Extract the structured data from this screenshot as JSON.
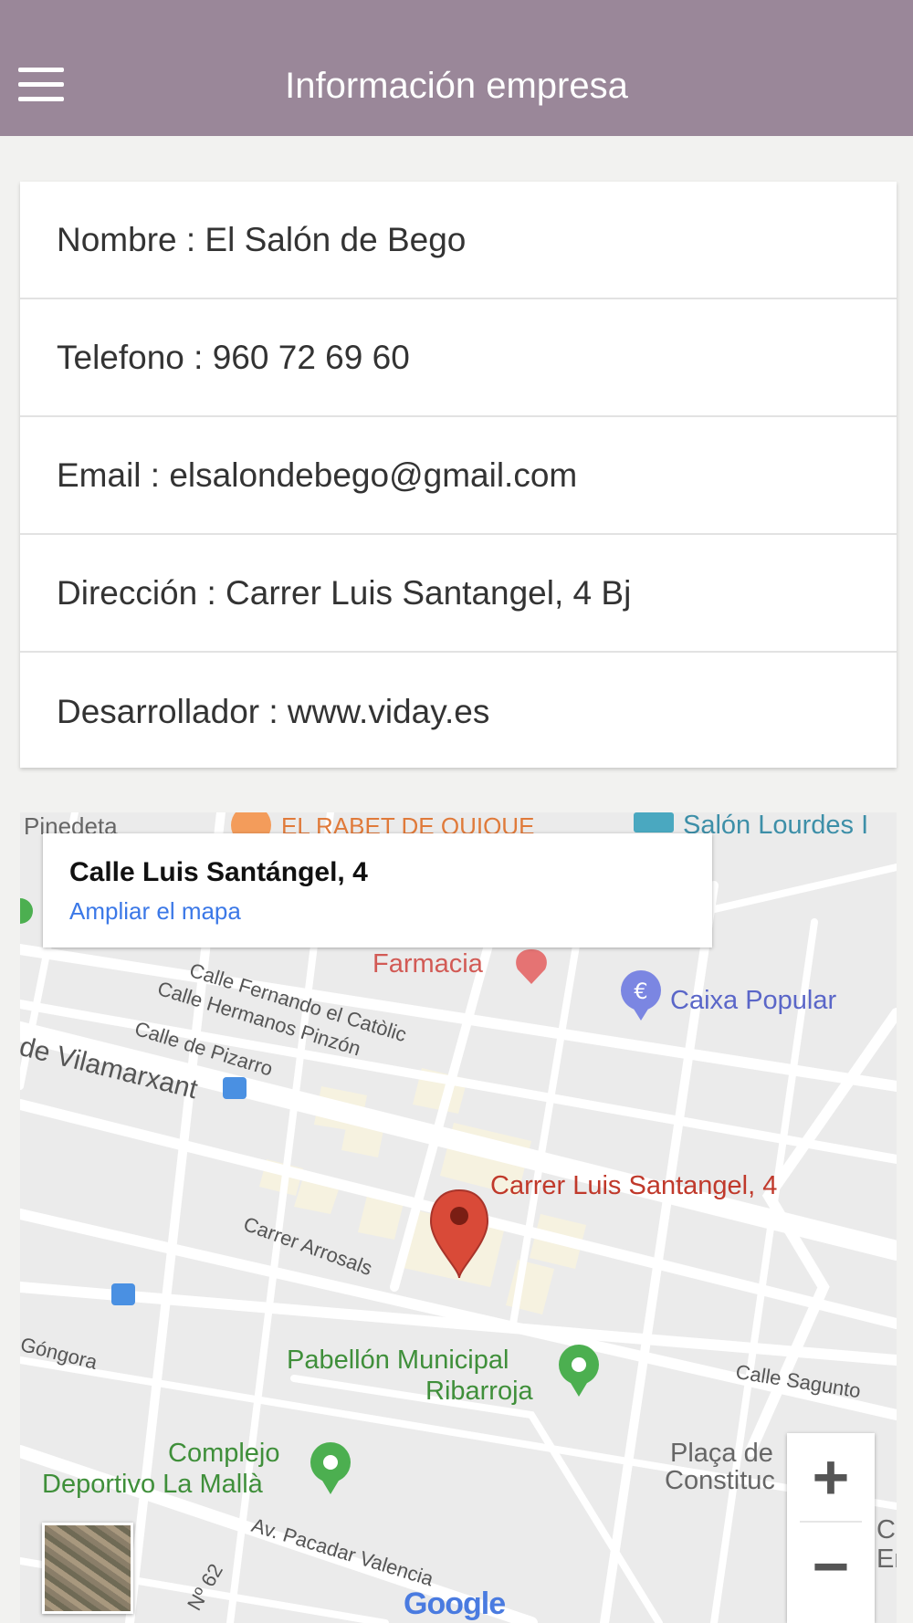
{
  "app_bar": {
    "title": "Información empresa"
  },
  "company": {
    "rows": [
      "Nombre : El Salón de Bego",
      "Telefono : 960 72 69 60",
      "Email : elsalondebego@gmail.com",
      "Dirección : Carrer Luis Santangel, 4 Bj",
      "Desarrollador : www.viday.es"
    ]
  },
  "map": {
    "place_title": "Calle Luis Santángel, 4",
    "enlarge_link": "Ampliar el mapa",
    "labels": {
      "top_left": "Pinedeta",
      "restaurant": "EL RABET DE QUIQUE",
      "salon": "Salón Lourdes I",
      "pharmacy": "Farmacia",
      "bank": "Caixa Popular",
      "marker": "Carrer Luis Santangel, 4",
      "pavilion_1": "Pabellón Municipal",
      "pavilion_2": "Ribarroja",
      "complex_1": "Complejo",
      "complex_2": "Deportivo La Mallà",
      "plaza_1": "Plaça de",
      "plaza_2": "Constituc",
      "right_edge_1": "Cc",
      "right_edge_2": "En",
      "street_1": "Calle Fernando el Catòlic",
      "street_2": "Calle Hermanos Pinzón",
      "street_3": "Calle de Pizarro",
      "street_4": "de Vilamarxant",
      "street_5": "Carrer Arrosals",
      "street_6": "Góngora",
      "street_7": "Calle Sagunto",
      "street_8": "Av. Pacadar Valencia",
      "street_9": "Nº 62"
    },
    "zoom_in": "+",
    "zoom_out": "−",
    "brand": "Google",
    "colors": {
      "marker": "#d94a38",
      "park": "#4caf50",
      "bank": "#7b86e2",
      "link": "#3b78e7"
    }
  }
}
